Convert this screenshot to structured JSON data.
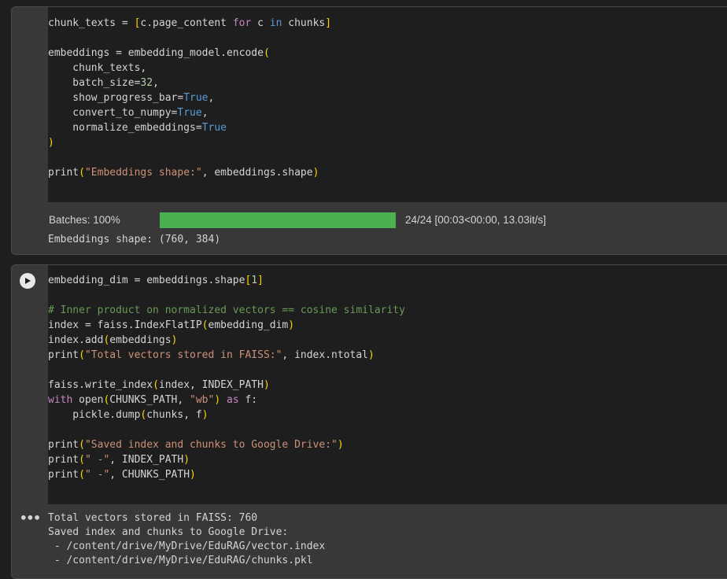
{
  "cell1": {
    "code": {
      "l1": [
        "chunk_texts = ",
        "[",
        "c.page_content ",
        "for",
        " c ",
        "in",
        " chunks",
        "]"
      ],
      "l3": [
        "embeddings = embedding_model.encode",
        "("
      ],
      "l4": "    chunk_texts,",
      "l5": [
        "    batch_size=",
        "32",
        ","
      ],
      "l6": [
        "    show_progress_bar=",
        "True",
        ","
      ],
      "l7": [
        "    convert_to_numpy=",
        "True",
        ","
      ],
      "l8": [
        "    normalize_embeddings=",
        "True"
      ],
      "l9": ")",
      "l11": [
        "print",
        "(",
        "\"Embeddings shape:\"",
        ", embeddings.shape",
        ")"
      ]
    },
    "output": {
      "progress_label": "Batches: 100%",
      "progress_fraction": 1.0,
      "progress_stats": "24/24 [00:03<00:00, 13.03it/s]",
      "shape_line": "Embeddings shape: (760, 384)"
    }
  },
  "cell2": {
    "run_icon": "play-icon",
    "code": {
      "l1": [
        "embedding_dim = embeddings.shape",
        "[",
        "1",
        "]"
      ],
      "l3": "# Inner product on normalized vectors == cosine similarity",
      "l4": [
        "index = faiss.IndexFlatIP",
        "(",
        "embedding_dim",
        ")"
      ],
      "l5": [
        "index.add",
        "(",
        "embeddings",
        ")"
      ],
      "l6": [
        "print",
        "(",
        "\"Total vectors stored in FAISS:\"",
        ", index.ntotal",
        ")"
      ],
      "l8": [
        "faiss.write_index",
        "(",
        "index, INDEX_PATH",
        ")"
      ],
      "l9": [
        "with",
        " open",
        "(",
        "CHUNKS_PATH, ",
        "\"wb\"",
        ")",
        " as",
        " f:"
      ],
      "l10": [
        "    pickle.dump",
        "(",
        "chunks, f",
        ")"
      ],
      "l12": [
        "print",
        "(",
        "\"Saved index and chunks to Google Drive:\"",
        ")"
      ],
      "l13": [
        "print",
        "(",
        "\" -\"",
        ", INDEX_PATH",
        ")"
      ],
      "l14": [
        "print",
        "(",
        "\" -\"",
        ", CHUNKS_PATH",
        ")"
      ]
    },
    "output": {
      "menu_icon": "more-horizontal-icon",
      "lines": [
        "Total vectors stored in FAISS: 760",
        "Saved index and chunks to Google Drive:",
        " - /content/drive/MyDrive/EduRAG/vector.index",
        " - /content/drive/MyDrive/EduRAG/chunks.pkl"
      ]
    }
  }
}
